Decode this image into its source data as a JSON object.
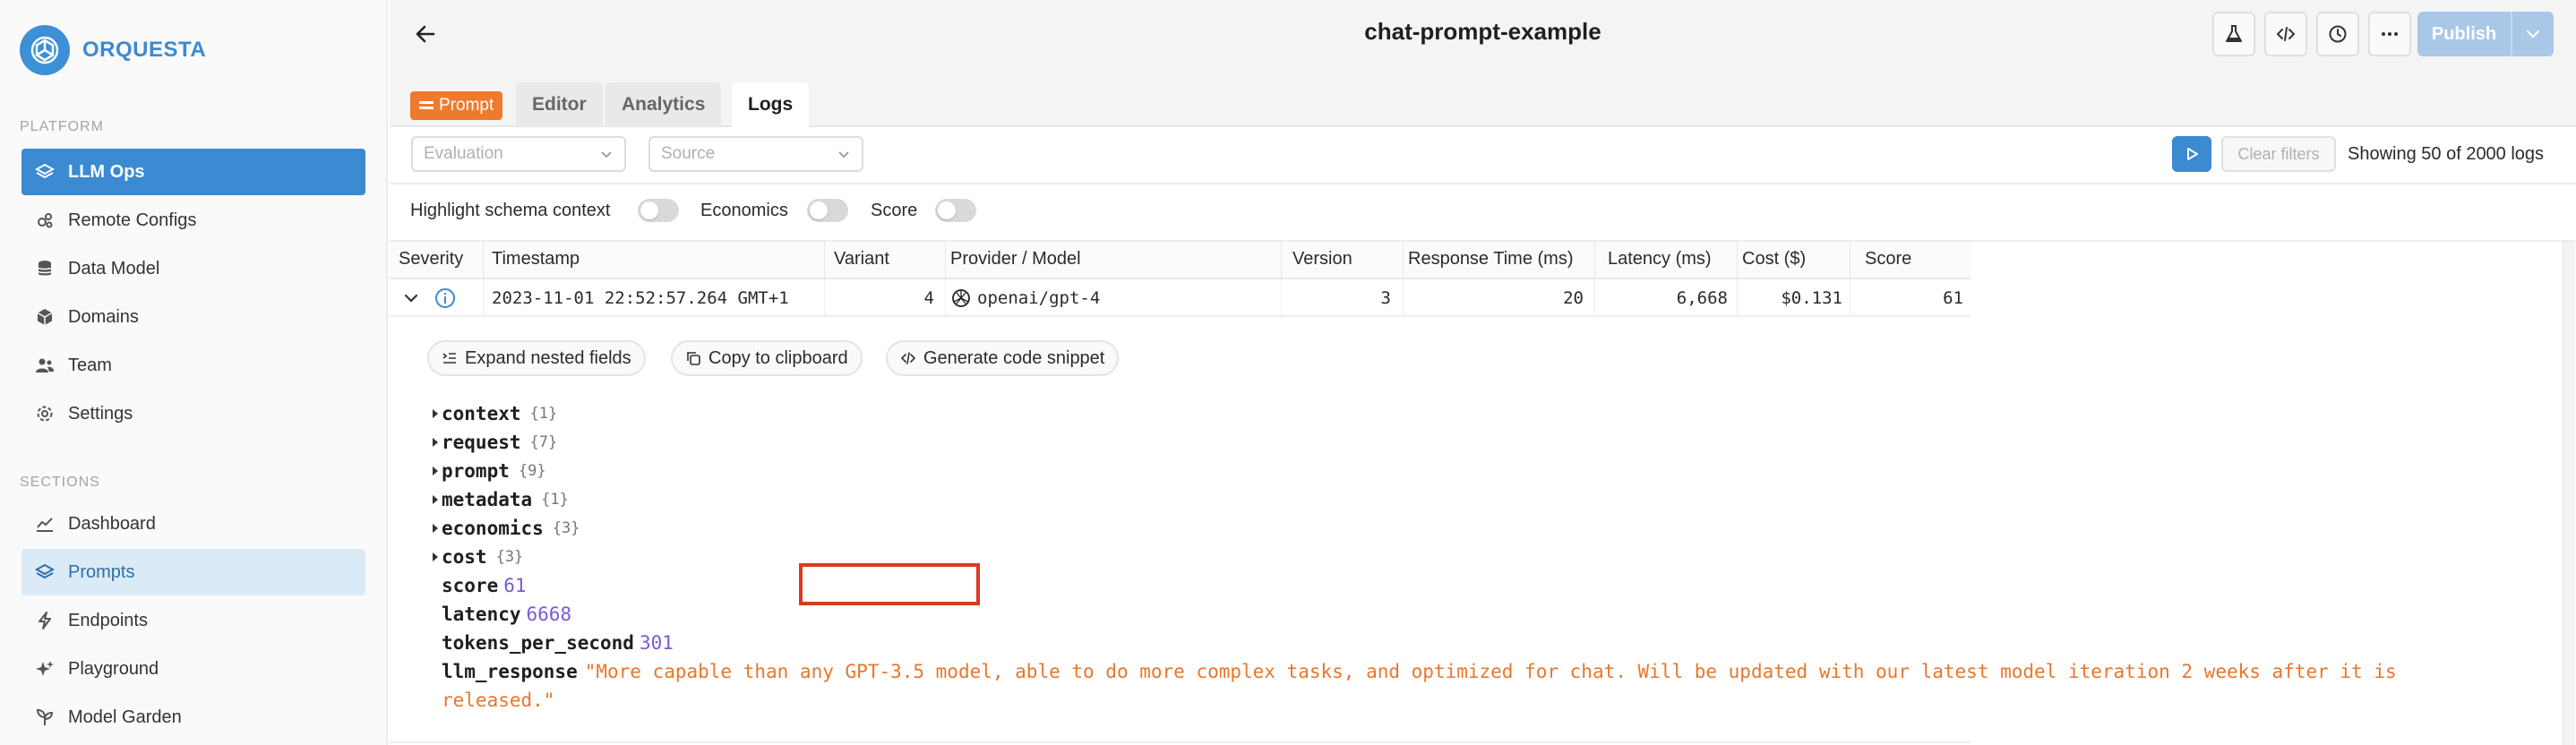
{
  "brand": {
    "name": "ORQUESTA"
  },
  "sidebar": {
    "platform_label": "PLATFORM",
    "platform_items": [
      {
        "label": "LLM Ops",
        "icon": "layers-icon"
      },
      {
        "label": "Remote Configs",
        "icon": "gear-cluster-icon"
      },
      {
        "label": "Data Model",
        "icon": "database-icon"
      },
      {
        "label": "Domains",
        "icon": "cube-icon"
      },
      {
        "label": "Team",
        "icon": "users-icon"
      },
      {
        "label": "Settings",
        "icon": "gear-icon"
      }
    ],
    "sections_label": "SECTIONS",
    "section_items": [
      {
        "label": "Dashboard",
        "icon": "chart-line-icon"
      },
      {
        "label": "Prompts",
        "icon": "layers-icon"
      },
      {
        "label": "Endpoints",
        "icon": "bolt-icon"
      },
      {
        "label": "Playground",
        "icon": "sparkle-icon"
      },
      {
        "label": "Model Garden",
        "icon": "plant-icon"
      }
    ]
  },
  "header": {
    "title": "chat-prompt-example",
    "publish_label": "Publish"
  },
  "tabs": {
    "badge": "Prompt",
    "items": [
      "Editor",
      "Analytics",
      "Logs"
    ],
    "active": "Logs"
  },
  "filters": {
    "evaluation_placeholder": "Evaluation",
    "source_placeholder": "Source",
    "clear_label": "Clear filters",
    "showing_text": "Showing 50 of 2000 logs"
  },
  "toggles": {
    "highlight_label": "Highlight schema context",
    "economics_label": "Economics",
    "score_label": "Score"
  },
  "table": {
    "columns": [
      "Severity",
      "Timestamp",
      "Variant",
      "Provider / Model",
      "Version",
      "Response Time (ms)",
      "Latency (ms)",
      "Cost ($)",
      "Score"
    ],
    "row": {
      "timestamp": "2023-11-01 22:52:57.264 GMT+1",
      "variant": "4",
      "model": "openai/gpt-4",
      "version": "3",
      "response_time": "20",
      "latency": "6,668",
      "cost": "$0.131",
      "score": "61"
    }
  },
  "detail": {
    "expand_label": "Expand nested fields",
    "copy_label": "Copy to clipboard",
    "snippet_label": "Generate code snippet",
    "tree": [
      {
        "key": "context",
        "count": "{1}"
      },
      {
        "key": "request",
        "count": "{7}"
      },
      {
        "key": "prompt",
        "count": "{9}"
      },
      {
        "key": "metadata",
        "count": "{1}"
      },
      {
        "key": "economics",
        "count": "{3}"
      },
      {
        "key": "cost",
        "count": "{3}"
      }
    ],
    "score_key": "score",
    "score_val": "61",
    "latency_key": "latency",
    "latency_val": "6668",
    "tps_key": "tokens_per_second",
    "tps_val": "301",
    "llm_key": "llm_response",
    "llm_line1": "\"More capable than any GPT-3.5 model, able to do more complex tasks, and optimized for chat. Will be updated with our latest model iteration 2 weeks after it is",
    "llm_line2": "released.\""
  },
  "colors": {
    "brand": "#3b8ad2",
    "prompt_badge": "#ee7a2e",
    "highlight": "#d83a24",
    "string_value": "#e8772b",
    "number_value": "#7a5ad6"
  }
}
